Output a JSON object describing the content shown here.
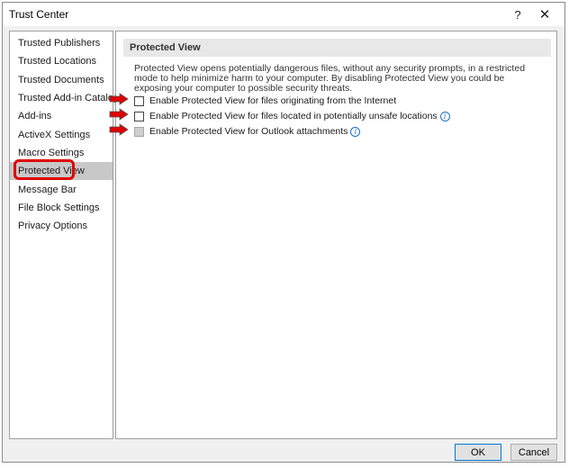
{
  "window": {
    "title": "Trust Center",
    "help_glyph": "?",
    "close_glyph": "✕"
  },
  "sidebar": {
    "items": [
      {
        "label": "Trusted Publishers"
      },
      {
        "label": "Trusted Locations"
      },
      {
        "label": "Trusted Documents"
      },
      {
        "label": "Trusted Add-in Catalogs"
      },
      {
        "label": "Add-ins"
      },
      {
        "label": "ActiveX Settings"
      },
      {
        "label": "Macro Settings"
      },
      {
        "label": "Protected View",
        "selected": true
      },
      {
        "label": "Message Bar"
      },
      {
        "label": "File Block Settings"
      },
      {
        "label": "Privacy Options"
      }
    ]
  },
  "main": {
    "header": "Protected View",
    "description": "Protected View opens potentially dangerous files, without any security prompts, in a restricted mode to help minimize harm to your computer. By disabling Protected View you could be exposing your computer to possible security threats.",
    "options": [
      {
        "label": "Enable Protected View for files originating from the Internet",
        "checked": false,
        "disabled": false,
        "info": false
      },
      {
        "label": "Enable Protected View for files located in potentially unsafe locations",
        "checked": false,
        "disabled": false,
        "info": true
      },
      {
        "label": "Enable Protected View for Outlook attachments",
        "checked": false,
        "disabled": true,
        "info": true
      }
    ]
  },
  "footer": {
    "ok_label": "OK",
    "cancel_label": "Cancel"
  },
  "colors": {
    "annotation_red": "#e00000",
    "selected_bg": "#c8c8c8"
  }
}
